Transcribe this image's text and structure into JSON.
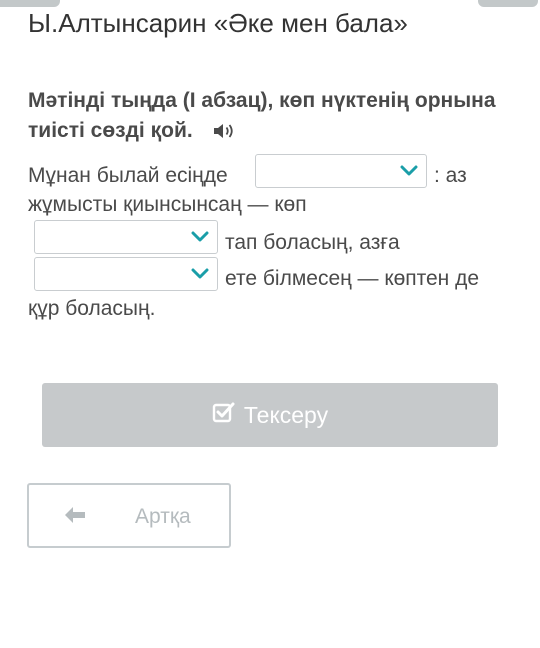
{
  "lesson": {
    "title": "Ы.Алтынсарин «Әке мен бала»"
  },
  "task": {
    "instruction": "Мәтінді тыңда (I абзац), көп нүктенің орнына тиісті сөзді қой.",
    "audio_icon": "speaker-icon"
  },
  "passage": {
    "seg1": "Мұнан былай есіңде",
    "seg2": ": аз",
    "seg3": "жұмысты қиынсынсаң — көп",
    "seg4": "тап боласың, азға",
    "seg5": "ете білмесең — көптен де",
    "seg6": "құр боласың."
  },
  "dropdowns": [
    {
      "selected": ""
    },
    {
      "selected": ""
    },
    {
      "selected": ""
    }
  ],
  "buttons": {
    "check_label": "Тексеру",
    "back_label": "Артқа"
  },
  "icons": {
    "check": "check-square-icon",
    "back": "arrow-left-icon",
    "dropdown": "chevron-down-icon"
  },
  "colors": {
    "chevron": "#1a9ea8",
    "check_button_bg": "#c6c9cb",
    "back_button_border": "#c6cccf"
  }
}
